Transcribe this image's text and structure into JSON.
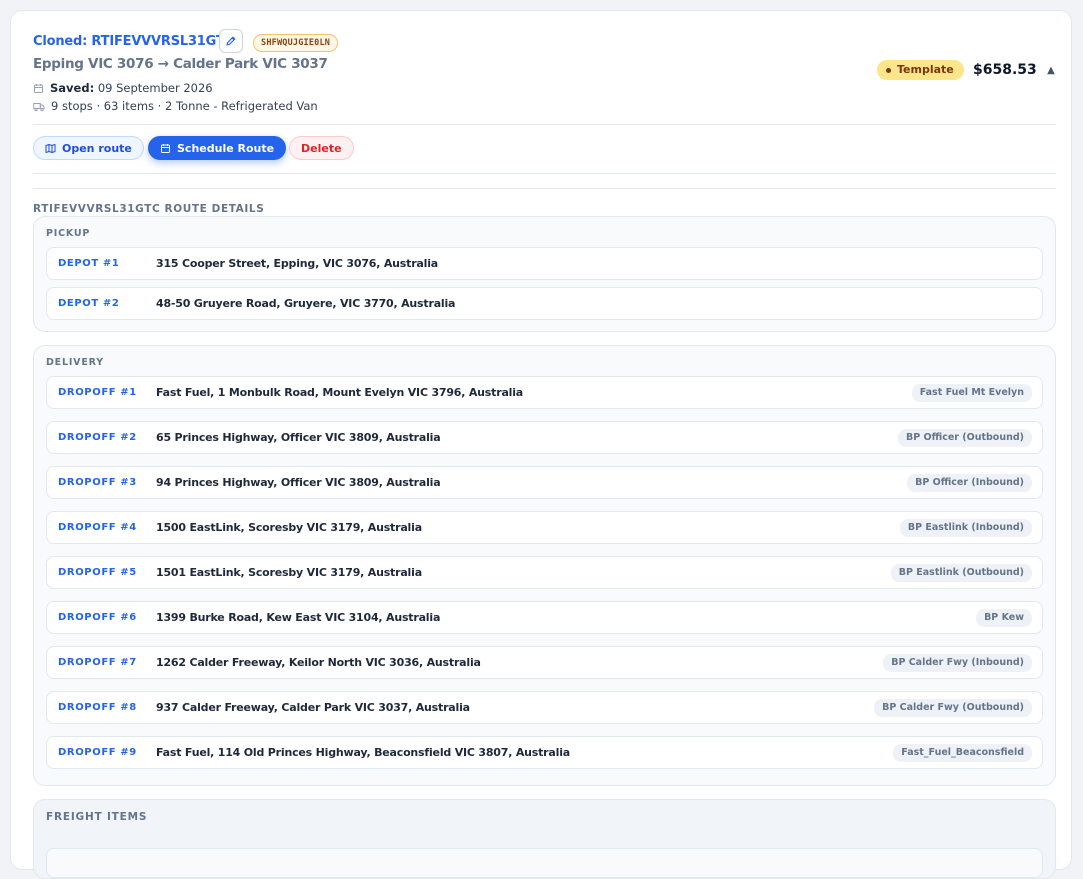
{
  "header": {
    "cloned_title": "Cloned: RTIFEVVVRSL31GTC",
    "reference_code": "SHFWQUJGIE0LN",
    "route_summary": "Epping VIC 3076 → Calder Park VIC 3037",
    "saved_label": "Saved:",
    "saved_date": "09 September 2026",
    "stops_summary": "9 stops · 63 items · 2 Tonne - Refrigerated Van",
    "status_badge": "Template",
    "price": "$658.53"
  },
  "actions": {
    "open_route": "Open route",
    "schedule_route": "Schedule Route",
    "delete": "Delete"
  },
  "route_details": {
    "title": "RTIFEVVVRSL31GTC ROUTE DETAILS",
    "pickup": {
      "label": "PICKUP",
      "stops": [
        {
          "label": "DEPOT #1",
          "address": "315 Cooper Street, Epping, VIC 3076, Australia"
        },
        {
          "label": "DEPOT #2",
          "address": "48-50 Gruyere Road, Gruyere, VIC 3770, Australia"
        }
      ]
    },
    "delivery": {
      "label": "DELIVERY",
      "stops": [
        {
          "label": "DROPOFF #1",
          "address": "Fast Fuel, 1 Monbulk Road, Mount Evelyn VIC 3796, Australia",
          "tag": "Fast Fuel Mt Evelyn"
        },
        {
          "label": "DROPOFF #2",
          "address": "65 Princes Highway, Officer VIC 3809, Australia",
          "tag": "BP Officer (Outbound)"
        },
        {
          "label": "DROPOFF #3",
          "address": "94 Princes Highway, Officer VIC 3809, Australia",
          "tag": "BP Officer (Inbound)"
        },
        {
          "label": "DROPOFF #4",
          "address": "1500 EastLink, Scoresby VIC 3179, Australia",
          "tag": "BP Eastlink (Inbound)"
        },
        {
          "label": "DROPOFF #5",
          "address": "1501 EastLink, Scoresby VIC 3179, Australia",
          "tag": "BP Eastlink (Outbound)"
        },
        {
          "label": "DROPOFF #6",
          "address": "1399 Burke Road, Kew East VIC 3104, Australia",
          "tag": "BP Kew"
        },
        {
          "label": "DROPOFF #7",
          "address": "1262 Calder Freeway, Keilor North VIC 3036, Australia",
          "tag": "BP Calder Fwy (Inbound)"
        },
        {
          "label": "DROPOFF #8",
          "address": "937 Calder Freeway, Calder Park VIC 3037, Australia",
          "tag": "BP Calder Fwy (Outbound)"
        },
        {
          "label": "DROPOFF #9",
          "address": "Fast Fuel, 114 Old Princes Highway, Beaconsfield VIC 3807, Australia",
          "tag": "Fast_Fuel_Beaconsfield"
        }
      ]
    }
  },
  "freight": {
    "title": "FREIGHT ITEMS"
  }
}
